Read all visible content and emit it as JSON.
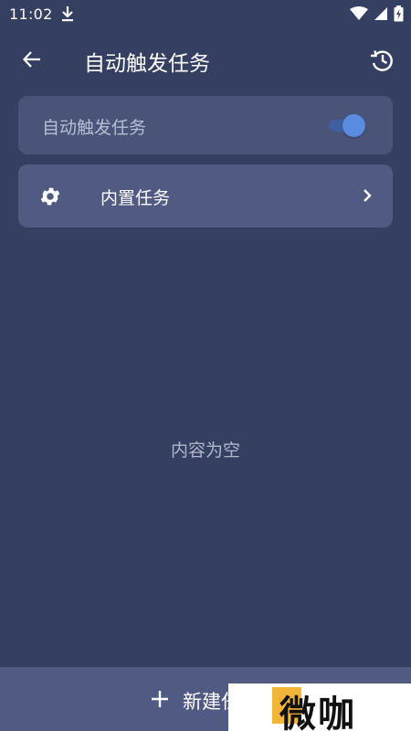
{
  "status_bar": {
    "time": "11:02"
  },
  "app_bar": {
    "title": "自动触发任务"
  },
  "toggle_card": {
    "label": "自动触发任务",
    "enabled": true
  },
  "builtin_card": {
    "label": "内置任务"
  },
  "empty_state": {
    "text": "内容为空"
  },
  "bottom_bar": {
    "label": "新建任务"
  },
  "watermark": {
    "text": "微咖"
  },
  "colors": {
    "background": "#353f62",
    "card": "#4a5479",
    "card_alt": "#505a82",
    "accent": "#5a8ce0"
  }
}
